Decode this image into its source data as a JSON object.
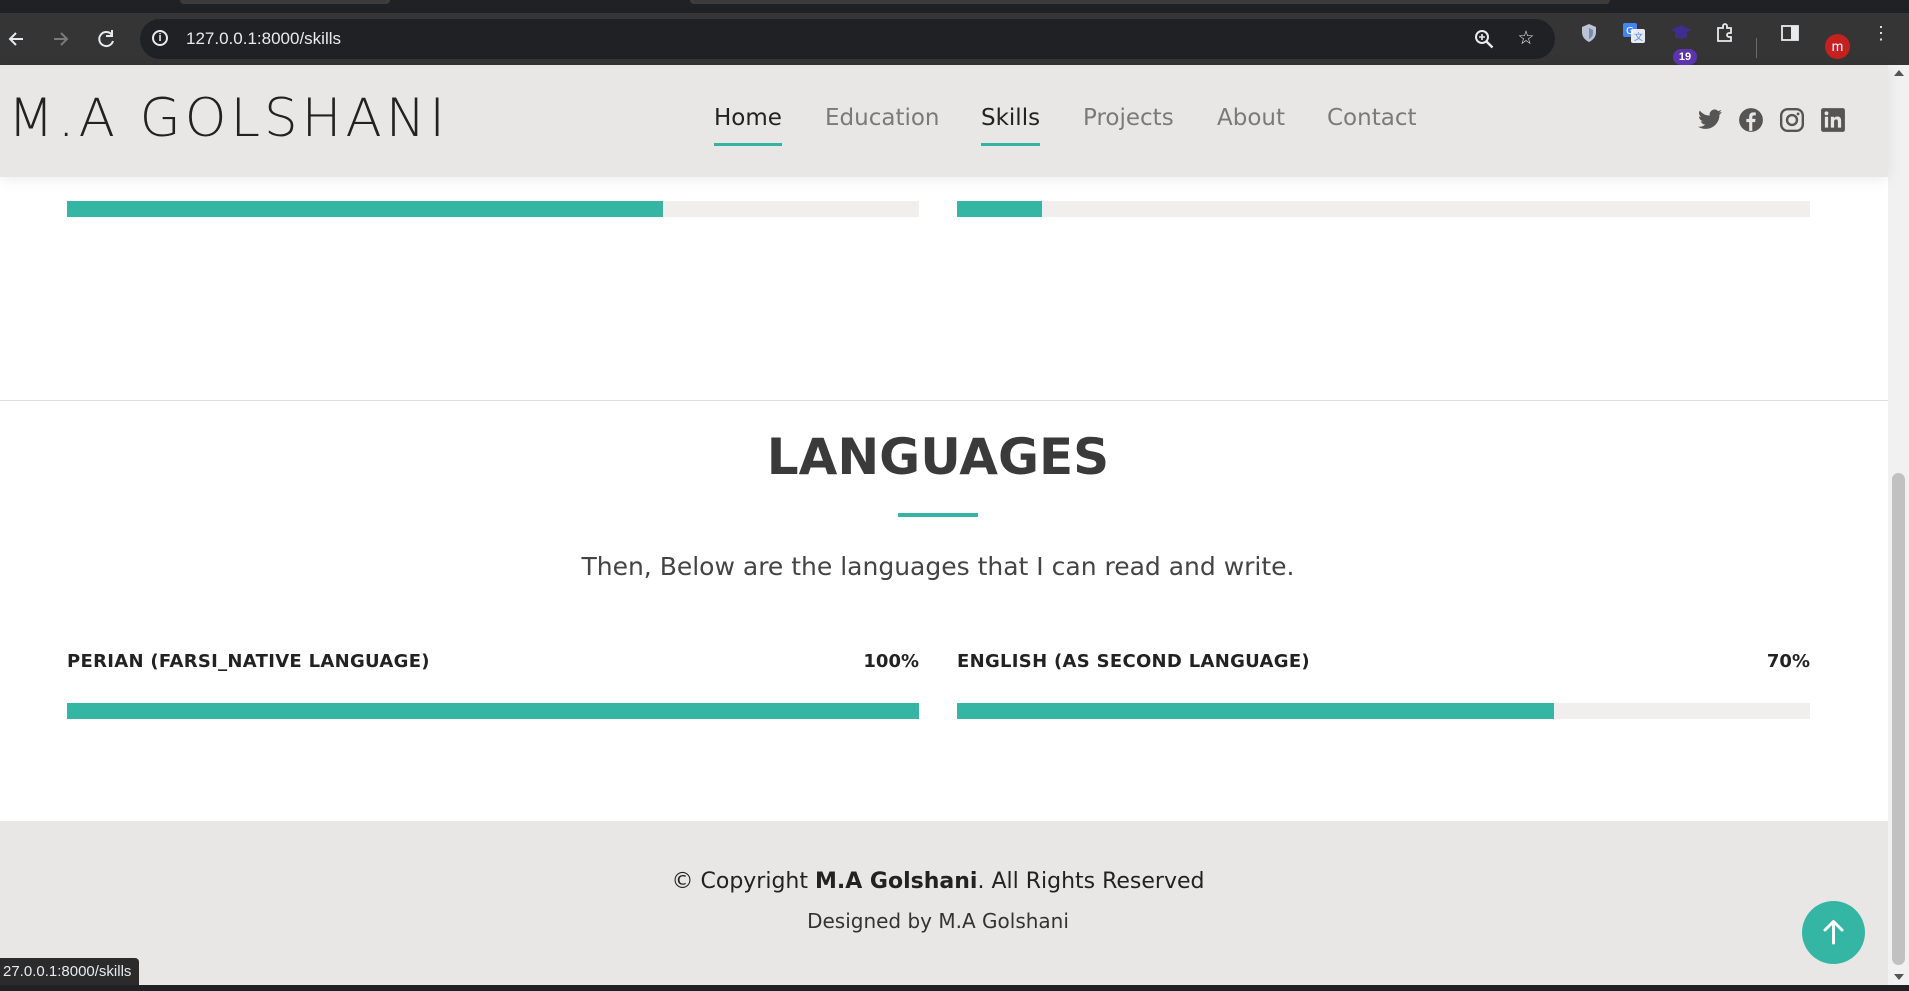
{
  "browser": {
    "url": "127.0.0.1:8000/skills",
    "back_icon": "arrow-left-icon",
    "forward_icon": "arrow-right-icon",
    "reload_icon": "reload-icon",
    "extension_badge": "19",
    "profile_initial": "m",
    "status_url": "27.0.0.1:8000/skills"
  },
  "header": {
    "logo": "M.A GOLSHANI",
    "nav": [
      {
        "label": "Home",
        "active": true
      },
      {
        "label": "Education",
        "active": false
      },
      {
        "label": "Skills",
        "active": true
      },
      {
        "label": "Projects",
        "active": false
      },
      {
        "label": "About",
        "active": false
      },
      {
        "label": "Contact",
        "active": false
      }
    ],
    "social_icons": [
      "twitter-icon",
      "facebook-icon",
      "instagram-icon",
      "linkedin-icon"
    ]
  },
  "previous_skills": [
    {
      "progress": 0.7
    },
    {
      "progress": 0.1
    }
  ],
  "languages": {
    "title": "LANGUAGES",
    "subtitle": "Then, Below are the languages that I can read and write.",
    "items": [
      {
        "label": "PERIAN (FARSI_NATIVE LANGUAGE)",
        "percent_text": "100%",
        "progress": 1.0
      },
      {
        "label": "ENGLISH (AS SECOND LANGUAGE)",
        "percent_text": "70%",
        "progress": 0.7
      }
    ]
  },
  "footer": {
    "copyright_prefix": "© Copyright ",
    "copyright_name": "M.A Golshani",
    "copyright_suffix": ". All Rights Reserved",
    "designed_by": "Designed by M.A Golshani"
  },
  "colors": {
    "accent": "#35b6a4",
    "header_bg": "#e9e7e5",
    "track": "#f0efee"
  }
}
